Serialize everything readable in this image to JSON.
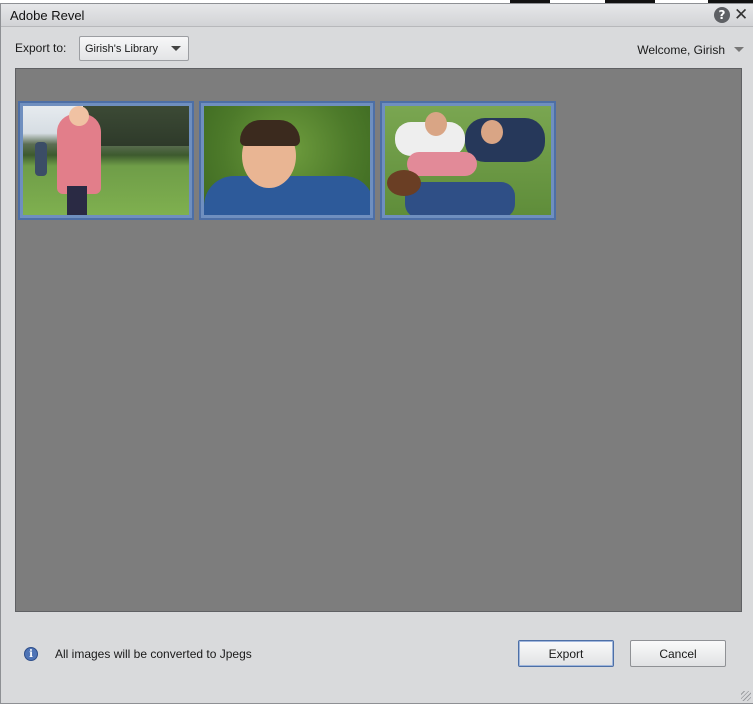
{
  "window": {
    "title": "Adobe Revel"
  },
  "header": {
    "export_label": "Export to:",
    "library_select": {
      "value": "Girish's Library"
    },
    "welcome": "Welcome, Girish"
  },
  "gallery": {
    "thumbnails": [
      {
        "subject": "girl running on grass"
      },
      {
        "subject": "boy lying on grass"
      },
      {
        "subject": "family lying on grass"
      }
    ]
  },
  "footer": {
    "info_text": "All images will be converted to Jpegs",
    "export_button": "Export",
    "cancel_button": "Cancel"
  },
  "icons": {
    "help": "help-icon",
    "close": "close-icon",
    "info": "info-icon",
    "dropdown": "chevron-down-icon"
  },
  "colors": {
    "dialog_bg": "#d9dadc",
    "gallery_bg": "#7d7d7d",
    "selection": "#6f8fbf",
    "accent": "#4d6fa6"
  }
}
